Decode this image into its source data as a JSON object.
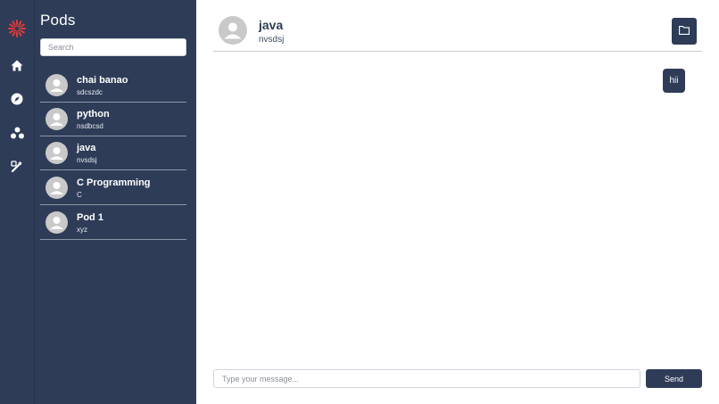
{
  "rail": {
    "icons": [
      "logo-icon",
      "home-icon",
      "compass-icon",
      "pods-icon",
      "tools-icon"
    ],
    "logo_color": "#e53935"
  },
  "sidebar": {
    "title": "Pods",
    "search_placeholder": "Search",
    "pods": [
      {
        "name": "chai banao",
        "subtitle": "sdcszdc"
      },
      {
        "name": "python",
        "subtitle": "nsdbcsd"
      },
      {
        "name": "java",
        "subtitle": "nvsdsj"
      },
      {
        "name": "C Programming",
        "subtitle": "C"
      },
      {
        "name": "Pod 1",
        "subtitle": "xyz"
      }
    ]
  },
  "chat": {
    "header": {
      "name": "java",
      "subtitle": "nvsdsj",
      "folder_icon": "folder-icon"
    },
    "messages": [
      {
        "text": "hii",
        "from": "self"
      }
    ],
    "input_placeholder": "Type your message...",
    "send_label": "Send"
  },
  "colors": {
    "navy": "#2e3c57",
    "divider": "#c8ccd2"
  }
}
